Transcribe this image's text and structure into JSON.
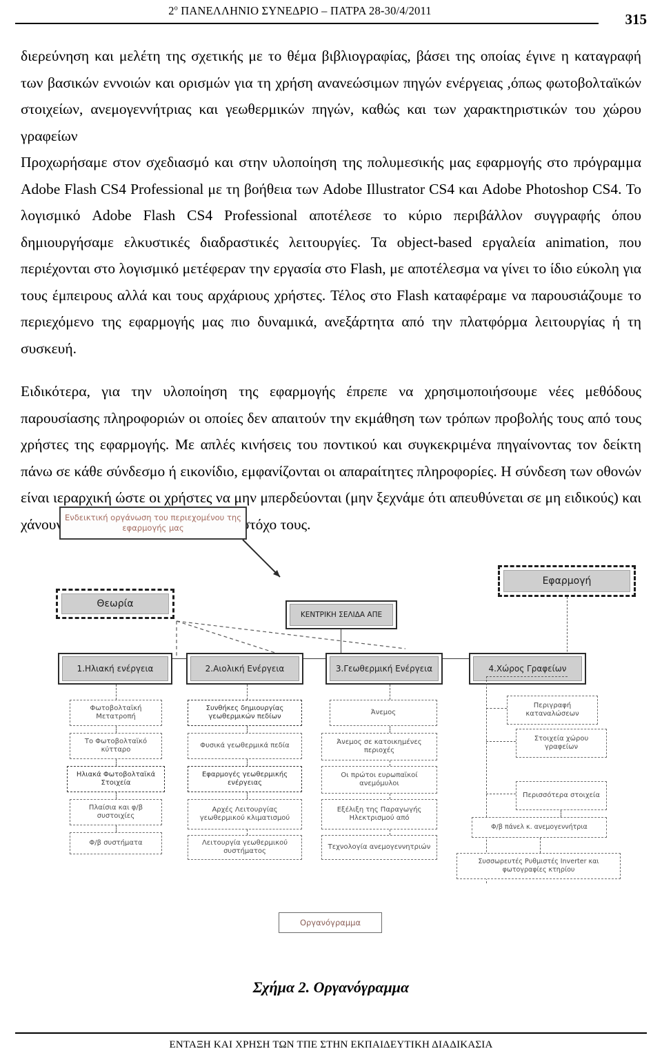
{
  "header": {
    "conference": "2",
    "conference_sup": "ο",
    "conference_rest": " ΠΑΝΕΛΛΗΝΙΟ ΣΥΝΕΔΡΙΟ – ΠΑΤΡΑ 28-30/4/2011",
    "page_number": "315"
  },
  "body": {
    "paragraph_1": "διερεύνηση και μελέτη της σχετικής με το θέμα βιβλιογραφίας, βάσει της οποίας έγινε η καταγραφή των βασικών εννοιών και ορισμών για τη  χρήση ανανεώσιμων πηγών ενέργειας ,όπως φωτοβολταϊκών στοιχείων, ανεμογεννήτριας και γεωθερμικών πηγών, καθώς και των χαρακτηριστικών του χώρου γραφείων",
    "paragraph_2": "Προχωρήσαμε στον σχεδιασμό και στην υλοποίηση της πολυμεσικής μας εφαρμογής στο πρόγραμμα Adobe Flash CS4 Professional με τη βοήθεια των Adobe Illustrator CS4 και Adobe Photoshop CS4. Το λογισμικό Adobe Flash CS4 Professional αποτέλεσε το κύριο περιβάλλον συγγραφής όπου δημιουργήσαμε ελκυστικές διαδραστικές λειτουργίες. Τα object-based εργαλεία animation, που περιέχονται στο λογισμικό μετέφεραν την εργασία στο  Flash, με αποτέλεσμα να γίνει το ίδιο εύκολη για τους έμπειρους αλλά και τους αρχάριους χρήστες. Τέλος στο Flash καταφέραμε να παρουσιάζουμε το περιεχόμενο της εφαρμογής μας πιο δυναμικά, ανεξάρτητα από την πλατφόρμα λειτουργίας ή τη συσκευή.",
    "paragraph_3": "Ειδικότερα, για την υλοποίηση της εφαρμογής έπρεπε να χρησιμοποιήσουμε νέες μεθόδους παρουσίασης πληροφοριών οι οποίες δεν απαιτούν την εκμάθηση των τρόπων προβολής τους από τους χρήστες της εφαρμογής. Με απλές κινήσεις του ποντικού και  συγκεκριμένα πηγαίνοντας τον δείκτη πάνω σε κάθε σύνδεσμο ή εικονίδιο, εμφανίζονται οι απαραίτητες πληροφορίες. Η σύνδεση των οθονών είναι ιεραρχική ώστε οι χρήστες να μην μπερδεύονται (μην ξεχνάμε ότι απευθύνεται σε μη ειδικούς) και χάνουν την πορεία τους ή τον τελικό στόχο τους."
  },
  "figure": {
    "title_box": "Ενδεικτική οργάνωση του περιεχομένου της εφαρμογής μας",
    "app_node": "Εφαρμογή",
    "theory_node": "Θεωρία",
    "central_node": "ΚΕΝΤΡΙΚΗ ΣΕΛΙΔΑ ΑΠΕ",
    "organogramma_box": "Οργανόγραμμα",
    "categories": [
      {
        "label": "1.Ηλιακή ενέργεια"
      },
      {
        "label": "2.Αιολική Ενέργεια"
      },
      {
        "label": "3.Γεωθερμική Ενέργεια"
      },
      {
        "label": "4.Χώρος Γραφείων"
      }
    ],
    "column_1": [
      "Φωτοβολταϊκή Μετατροπή",
      "Το Φωτοβολταϊκό κύτταρο",
      "Ηλιακά Φωτοβολταϊκά Στοιχεία",
      "Πλαίσια και φ/β συστοιχίες",
      "Φ/β συστήματα"
    ],
    "column_2": [
      "Συνθήκες δημιουργίας γεωθερμικών πεδίων",
      "Φυσικά γεωθερμικά πεδία",
      "Εφαρμογές γεωθερμικής ενέργειας",
      "Αρχές Λειτουργίας γεωθερμικού κλιματισμού",
      "Λειτουργία γεωθερμικού συστήματος"
    ],
    "column_3": [
      "Άνεμος",
      "Άνεμος σε κατοικημένες περιοχές",
      "Οι πρώτοι ευρωπαϊκοί ανεμόμυλοι",
      "Εξέλιξη της Παραγωγής Ηλεκτρισμού από",
      "Τεχνολογία ανεμογεννητριών"
    ],
    "column_4": [
      "Περιγραφή καταναλώσεων",
      "Στοιχεία χώρου γραφείων",
      "Περισσότερα στοιχεία",
      "Φ/β πάνελ κ. ανεμογεννήτρια",
      "Συσσωρευτές Ρυθμιστές Inverter και φωτογραφίες κτηρίου"
    ],
    "caption_label": "Σχήμα 2.",
    "caption_text": "Οργανόγραμμα"
  },
  "footer": {
    "text": "ΕΝΤΑΞΗ ΚΑΙ ΧΡΗΣΗ ΤΩΝ ΤΠΕ ΣΤΗΝ ΕΚΠΑΙΔΕΥΤΙΚΗ ΔΙΑΔΙΚΑΣΙΑ"
  }
}
